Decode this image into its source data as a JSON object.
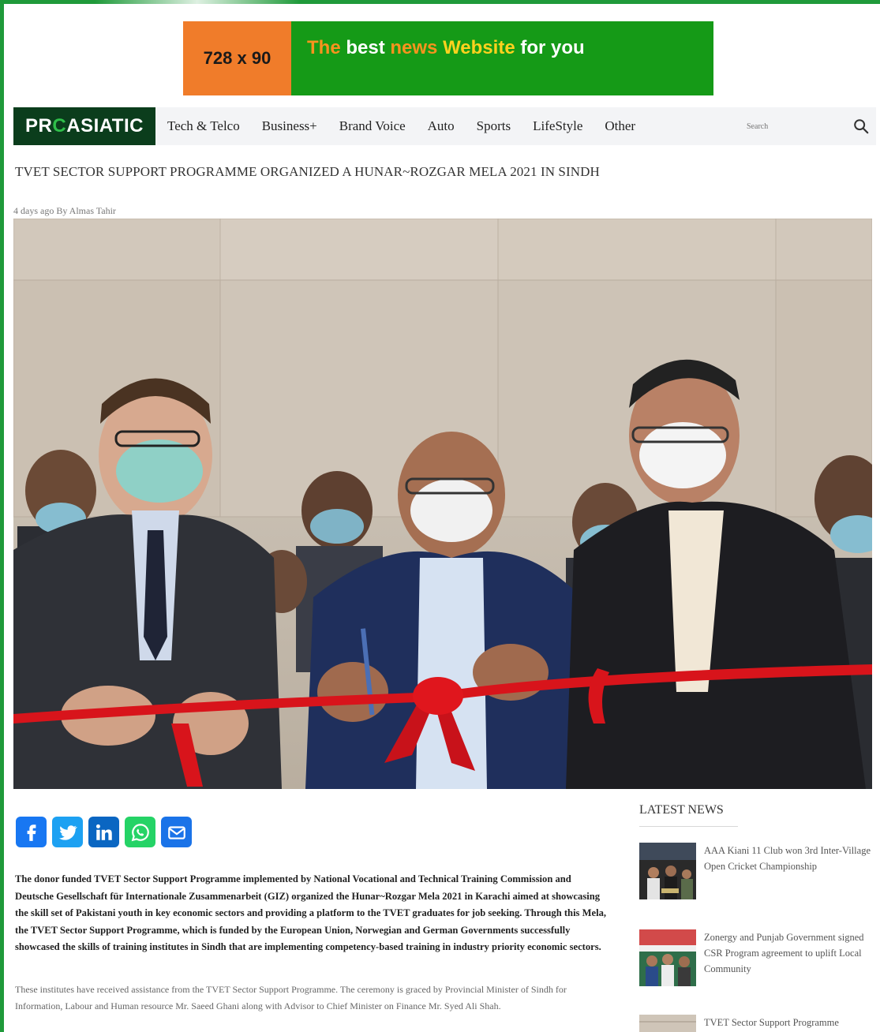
{
  "ad": {
    "size_label": "728 x 90",
    "word1": "The",
    "word2": "best",
    "word3": "news",
    "word4": "Website",
    "word5": "for you"
  },
  "nav": {
    "logo_left": "PR",
    "logo_mid": "C",
    "logo_right": "ASIATIC",
    "items": [
      "Tech & Telco",
      "Business+",
      "Brand Voice",
      "Auto",
      "Sports",
      "LifeStyle",
      "Other"
    ],
    "search_placeholder": "Search"
  },
  "article": {
    "headline": "TVET SECTOR SUPPORT PROGRAMME ORGANIZED A HUNAR~ROZGAR MELA 2021 IN SINDH",
    "meta": "4 days ago By Almas Tahir",
    "paragraph1": "The donor funded TVET Sector Support Programme implemented by National Vocational and Technical Training Commission and Deutsche Gesellschaft für Internationale Zusammenarbeit (GIZ) organized the Hunar~Rozgar Mela 2021 in Karachi aimed at showcasing the skill set of Pakistani youth in key economic sectors and providing a platform to the TVET graduates for job seeking. Through this Mela, the TVET Sector Support Programme, which is funded by the European Union, Norwegian and German Governments successfully showcased the skills of training institutes in Sindh that are implementing competency-based training in industry priority economic sectors.",
    "paragraph2": "These institutes have received assistance from the TVET Sector Support Programme. The ceremony is graced by Provincial Minister of Sindh for Information, Labour and Human resource Mr. Saeed Ghani along with Advisor to Chief Minister on Finance Mr. Syed Ali Shah."
  },
  "share": {
    "icons": [
      "facebook-icon",
      "twitter-icon",
      "linkedin-icon",
      "whatsapp-icon",
      "email-icon"
    ],
    "colors": {
      "facebook": "#1877f2",
      "twitter": "#1da1f2",
      "linkedin": "#0a66c2",
      "whatsapp": "#25d366",
      "email": "#1a73e8"
    }
  },
  "sidebar": {
    "title": "LATEST NEWS",
    "items": [
      {
        "title": "AAA Kiani 11 Club won 3rd Inter-Village Open Cricket Championship"
      },
      {
        "title": "Zonergy and Punjab Government signed CSR Program agreement to uplift Local Community"
      },
      {
        "title": "TVET Sector Support Programme"
      }
    ]
  },
  "colors": {
    "brand_green": "#1f9a3a",
    "logo_bg": "#0b3d1c",
    "ad_orange": "#f07c2a",
    "ad_green": "#159a17"
  }
}
